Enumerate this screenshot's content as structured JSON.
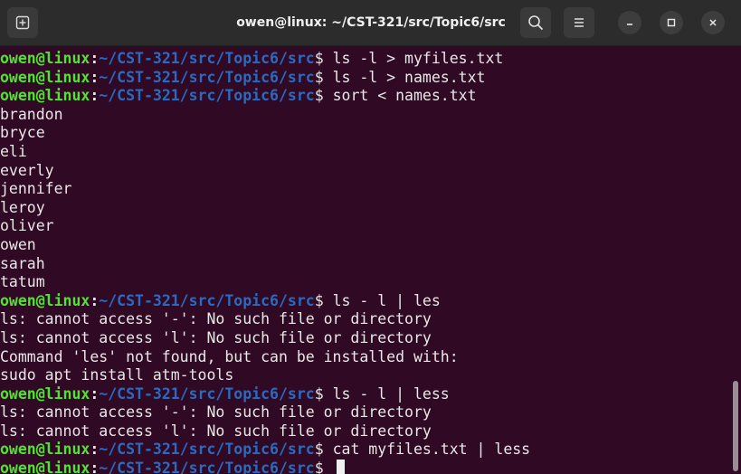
{
  "window": {
    "title": "owen@linux: ~/CST-321/src/Topic6/src"
  },
  "icons": {
    "new_tab": "new-tab-icon",
    "search": "search-icon",
    "menu": "hamburger-menu-icon",
    "minimize": "minimize-icon",
    "maximize": "maximize-icon",
    "close": "close-icon"
  },
  "colors": {
    "background": "#300a24",
    "titlebar": "#2c2c2c",
    "user_host": "#4ee62c",
    "path": "#2a6ac0",
    "text": "#e8e8e8"
  },
  "prompt": {
    "user_host": "owen@linux",
    "colon": ":",
    "path": "~/CST-321/src/Topic6/src",
    "symbol": "$"
  },
  "lines": [
    {
      "kind": "prompt",
      "command": " ls -l > myfiles.txt"
    },
    {
      "kind": "prompt",
      "command": " ls -l > names.txt"
    },
    {
      "kind": "prompt",
      "command": " sort < names.txt"
    },
    {
      "kind": "output",
      "text": "brandon"
    },
    {
      "kind": "output",
      "text": "bryce"
    },
    {
      "kind": "output",
      "text": "eli"
    },
    {
      "kind": "output",
      "text": "everly"
    },
    {
      "kind": "output",
      "text": "jennifer"
    },
    {
      "kind": "output",
      "text": "leroy"
    },
    {
      "kind": "output",
      "text": "oliver"
    },
    {
      "kind": "output",
      "text": "owen"
    },
    {
      "kind": "output",
      "text": "sarah"
    },
    {
      "kind": "output",
      "text": "tatum"
    },
    {
      "kind": "prompt",
      "command": " ls - l | les"
    },
    {
      "kind": "output",
      "text": "ls: cannot access '-': No such file or directory"
    },
    {
      "kind": "output",
      "text": "ls: cannot access 'l': No such file or directory"
    },
    {
      "kind": "output",
      "text": "Command 'les' not found, but can be installed with:"
    },
    {
      "kind": "output",
      "text": "sudo apt install atm-tools"
    },
    {
      "kind": "prompt",
      "command": " ls - l | less"
    },
    {
      "kind": "output",
      "text": "ls: cannot access '-': No such file or directory"
    },
    {
      "kind": "output",
      "text": "ls: cannot access 'l': No such file or directory"
    },
    {
      "kind": "prompt",
      "command": " cat myfiles.txt | less"
    },
    {
      "kind": "prompt",
      "command": " ",
      "cursor": true
    }
  ]
}
